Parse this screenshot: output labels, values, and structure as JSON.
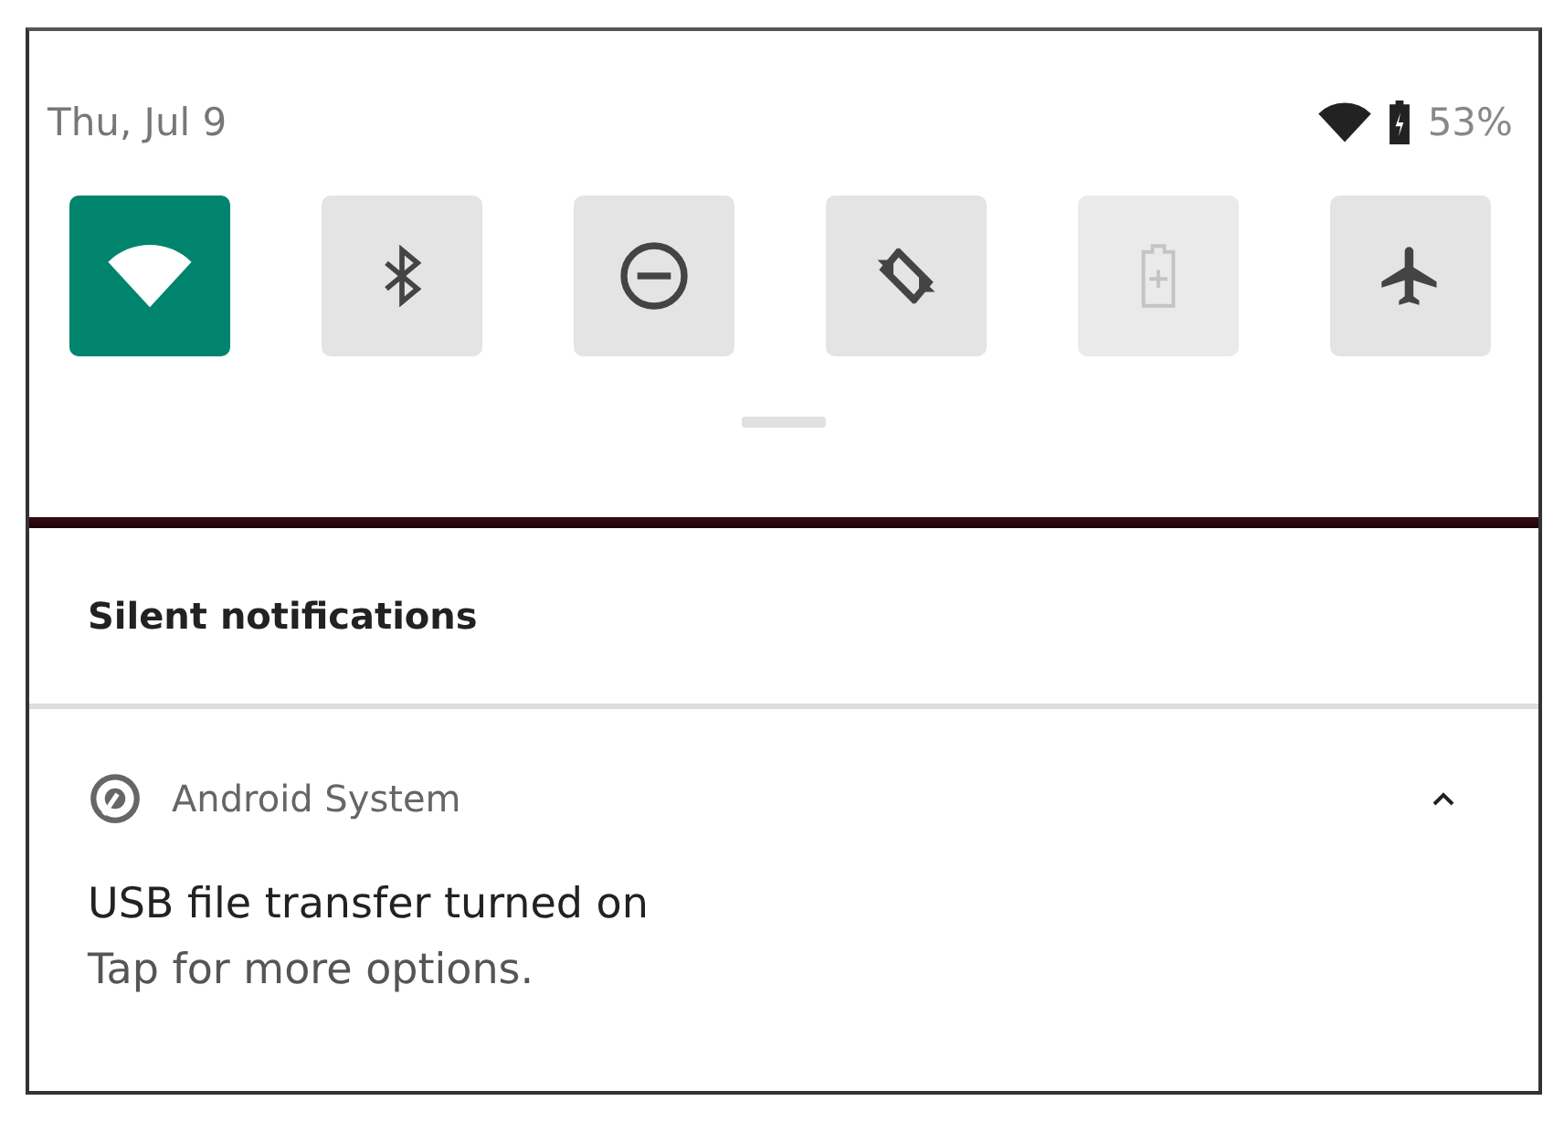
{
  "status_bar": {
    "date": "Thu, Jul 9",
    "battery_percent": "53%"
  },
  "quick_tiles": [
    {
      "kind": "wifi",
      "on": true,
      "disabled": false
    },
    {
      "kind": "bluetooth",
      "on": false,
      "disabled": false
    },
    {
      "kind": "do-not-disturb",
      "on": false,
      "disabled": false
    },
    {
      "kind": "auto-rotate",
      "on": false,
      "disabled": false
    },
    {
      "kind": "battery-saver",
      "on": false,
      "disabled": true
    },
    {
      "kind": "airplane",
      "on": false,
      "disabled": false
    }
  ],
  "section_header": "Silent notifications",
  "notification": {
    "app": "Android System",
    "expanded": true,
    "title": "USB file transfer turned on",
    "text": "Tap for more options."
  }
}
